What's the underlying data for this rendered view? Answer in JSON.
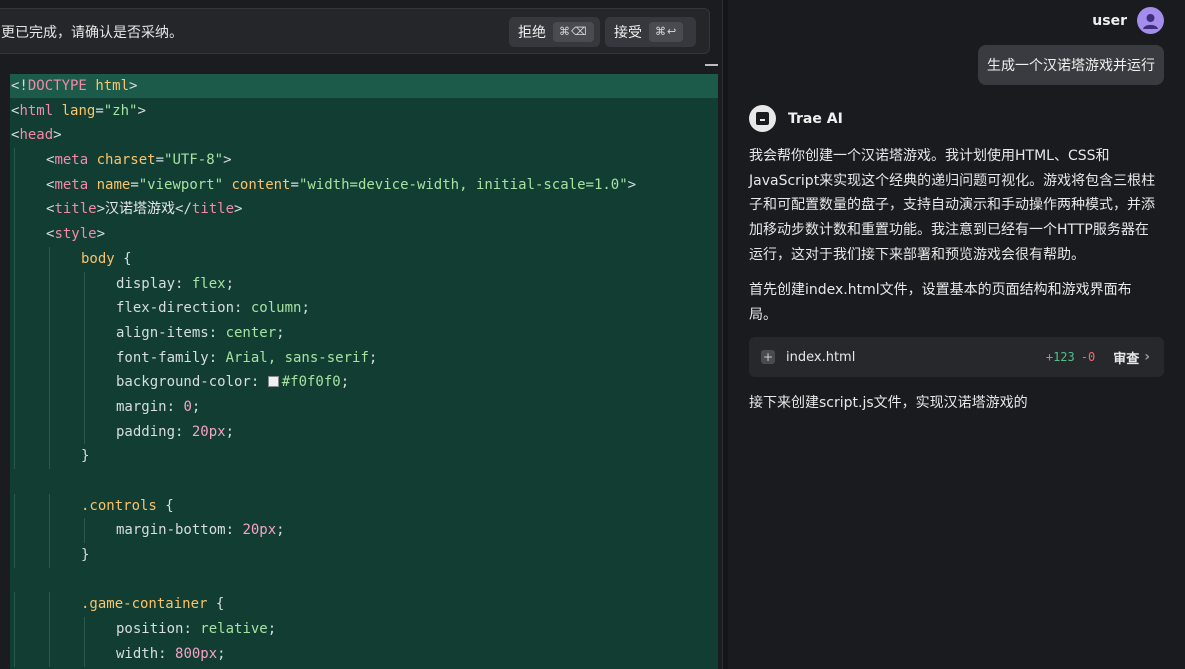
{
  "diff_banner": {
    "message": "更已完成，请确认是否采纳。",
    "reject_label": "拒绝",
    "reject_shortcut": "⌘⌫",
    "accept_label": "接受",
    "accept_shortcut": "⌘↩"
  },
  "editor": {
    "lines": [
      {
        "indent": 0,
        "tokens": [
          [
            "punct",
            "<!"
          ],
          [
            "tag",
            "DOCTYPE"
          ],
          [
            "punct",
            " "
          ],
          [
            "attr",
            "html"
          ],
          [
            "punct",
            ">"
          ]
        ]
      },
      {
        "indent": 0,
        "tokens": [
          [
            "punct",
            "<"
          ],
          [
            "tag",
            "html"
          ],
          [
            "punct",
            " "
          ],
          [
            "attr",
            "lang"
          ],
          [
            "punct",
            "="
          ],
          [
            "str",
            "\"zh\""
          ],
          [
            "punct",
            ">"
          ]
        ]
      },
      {
        "indent": 0,
        "tokens": [
          [
            "punct",
            "<"
          ],
          [
            "tag",
            "head"
          ],
          [
            "punct",
            ">"
          ]
        ]
      },
      {
        "indent": 1,
        "tokens": [
          [
            "punct",
            "<"
          ],
          [
            "tag",
            "meta"
          ],
          [
            "punct",
            " "
          ],
          [
            "attr",
            "charset"
          ],
          [
            "punct",
            "="
          ],
          [
            "str",
            "\"UTF-8\""
          ],
          [
            "punct",
            ">"
          ]
        ]
      },
      {
        "indent": 1,
        "tokens": [
          [
            "punct",
            "<"
          ],
          [
            "tag",
            "meta"
          ],
          [
            "punct",
            " "
          ],
          [
            "attr",
            "name"
          ],
          [
            "punct",
            "="
          ],
          [
            "str",
            "\"viewport\""
          ],
          [
            "punct",
            " "
          ],
          [
            "attr",
            "content"
          ],
          [
            "punct",
            "="
          ],
          [
            "str",
            "\"width=device-width, initial-scale=1.0\""
          ],
          [
            "punct",
            ">"
          ]
        ]
      },
      {
        "indent": 1,
        "tokens": [
          [
            "punct",
            "<"
          ],
          [
            "tag",
            "title"
          ],
          [
            "punct",
            ">"
          ],
          [
            "text",
            "汉诺塔游戏"
          ],
          [
            "punct",
            "</"
          ],
          [
            "tag",
            "title"
          ],
          [
            "punct",
            ">"
          ]
        ]
      },
      {
        "indent": 1,
        "tokens": [
          [
            "punct",
            "<"
          ],
          [
            "tag",
            "style"
          ],
          [
            "punct",
            ">"
          ]
        ]
      },
      {
        "indent": 2,
        "tokens": [
          [
            "sel",
            "body"
          ],
          [
            "punct",
            " {"
          ]
        ]
      },
      {
        "indent": 3,
        "tokens": [
          [
            "prop",
            "display"
          ],
          [
            "punct",
            ": "
          ],
          [
            "val",
            "flex"
          ],
          [
            "punct",
            ";"
          ]
        ]
      },
      {
        "indent": 3,
        "tokens": [
          [
            "prop",
            "flex-direction"
          ],
          [
            "punct",
            ": "
          ],
          [
            "val",
            "column"
          ],
          [
            "punct",
            ";"
          ]
        ]
      },
      {
        "indent": 3,
        "tokens": [
          [
            "prop",
            "align-items"
          ],
          [
            "punct",
            ": "
          ],
          [
            "val",
            "center"
          ],
          [
            "punct",
            ";"
          ]
        ]
      },
      {
        "indent": 3,
        "tokens": [
          [
            "prop",
            "font-family"
          ],
          [
            "punct",
            ": "
          ],
          [
            "val",
            "Arial, sans-serif"
          ],
          [
            "punct",
            ";"
          ]
        ]
      },
      {
        "indent": 3,
        "tokens": [
          [
            "prop",
            "background-color"
          ],
          [
            "punct",
            ": "
          ],
          [
            "swatch",
            ""
          ],
          [
            "val",
            "#f0f0f0"
          ],
          [
            "punct",
            ";"
          ]
        ]
      },
      {
        "indent": 3,
        "tokens": [
          [
            "prop",
            "margin"
          ],
          [
            "punct",
            ": "
          ],
          [
            "num",
            "0"
          ],
          [
            "punct",
            ";"
          ]
        ]
      },
      {
        "indent": 3,
        "tokens": [
          [
            "prop",
            "padding"
          ],
          [
            "punct",
            ": "
          ],
          [
            "num",
            "20px"
          ],
          [
            "punct",
            ";"
          ]
        ]
      },
      {
        "indent": 2,
        "tokens": [
          [
            "punct",
            "}"
          ]
        ]
      },
      {
        "indent": 0,
        "tokens": []
      },
      {
        "indent": 2,
        "tokens": [
          [
            "sel",
            ".controls"
          ],
          [
            "punct",
            " {"
          ]
        ]
      },
      {
        "indent": 3,
        "tokens": [
          [
            "prop",
            "margin-bottom"
          ],
          [
            "punct",
            ": "
          ],
          [
            "num",
            "20px"
          ],
          [
            "punct",
            ";"
          ]
        ]
      },
      {
        "indent": 2,
        "tokens": [
          [
            "punct",
            "}"
          ]
        ]
      },
      {
        "indent": 0,
        "tokens": []
      },
      {
        "indent": 2,
        "tokens": [
          [
            "sel",
            ".game-container"
          ],
          [
            "punct",
            " {"
          ]
        ]
      },
      {
        "indent": 3,
        "tokens": [
          [
            "prop",
            "position"
          ],
          [
            "punct",
            ": "
          ],
          [
            "val",
            "relative"
          ],
          [
            "punct",
            ";"
          ]
        ]
      },
      {
        "indent": 3,
        "tokens": [
          [
            "prop",
            "width"
          ],
          [
            "punct",
            ": "
          ],
          [
            "num",
            "800px"
          ],
          [
            "punct",
            ";"
          ]
        ]
      }
    ]
  },
  "chat": {
    "user_name": "user",
    "user_message": "生成一个汉诺塔游戏并运行",
    "ai_name": "Trae AI",
    "para1": "我会帮你创建一个汉诺塔游戏。我计划使用HTML、CSS和JavaScript来实现这个经典的递归问题可视化。游戏将包含三根柱子和可配置数量的盘子，支持自动演示和手动操作两种模式，并添加移动步数计数和重置功能。我注意到已经有一个HTTP服务器在运行，这对于我们接下来部署和预览游戏会很有帮助。",
    "para2": "首先创建index.html文件，设置基本的页面结构和游戏界面布局。",
    "file": {
      "name": "index.html",
      "additions": "+123",
      "deletions": "-0",
      "review_label": "审查"
    },
    "para3": "接下来创建script.js文件，实现汉诺塔游戏的"
  }
}
